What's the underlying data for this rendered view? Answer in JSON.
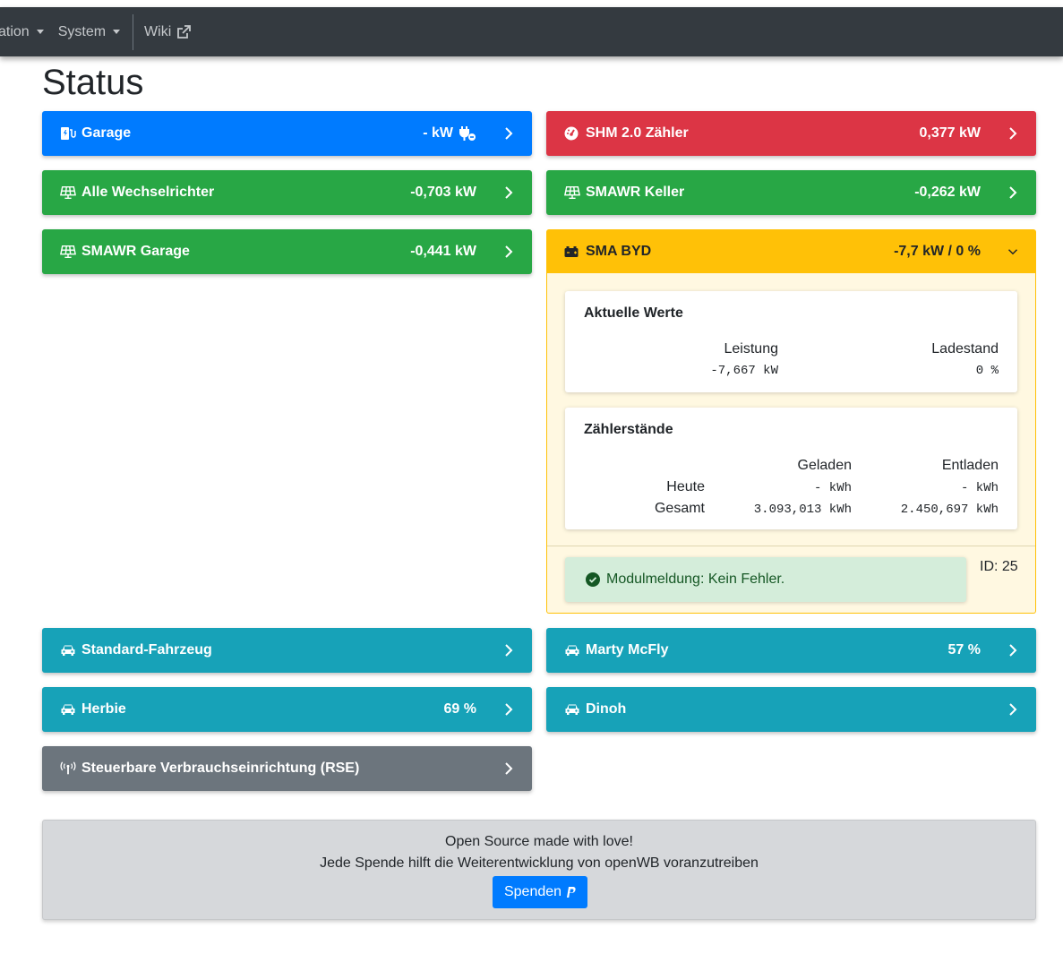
{
  "nav": {
    "item_partial": "ation",
    "system": "System",
    "wiki": "Wiki"
  },
  "page_title": "Status",
  "cards": {
    "garage": {
      "label": "Garage",
      "value": "- kW"
    },
    "shm": {
      "label": "SHM 2.0 Zähler",
      "value": "0,377 kW"
    },
    "alle_wr": {
      "label": "Alle Wechselrichter",
      "value": "-0,703 kW"
    },
    "smawr_keller": {
      "label": "SMAWR Keller",
      "value": "-0,262 kW"
    },
    "smawr_garage": {
      "label": "SMAWR Garage",
      "value": "-0,441 kW"
    },
    "sma_byd": {
      "label": "SMA BYD",
      "value": "-7,7 kW / 0 %"
    },
    "standard_fz": {
      "label": "Standard-Fahrzeug",
      "value": ""
    },
    "marty": {
      "label": "Marty McFly",
      "value": "57 %"
    },
    "herbie": {
      "label": "Herbie",
      "value": "69 %"
    },
    "dinoh": {
      "label": "Dinoh",
      "value": ""
    },
    "rse": {
      "label": "Steuerbare Verbrauchseinrichtung (RSE)",
      "value": ""
    }
  },
  "byd_detail": {
    "current": {
      "title": "Aktuelle Werte",
      "leistung_label": "Leistung",
      "leistung_value": "-7,667 kW",
      "ladestand_label": "Ladestand",
      "ladestand_value": "0 %"
    },
    "counters": {
      "title": "Zählerstände",
      "geladen": "Geladen",
      "entladen": "Entladen",
      "heute": "Heute",
      "gesamt": "Gesamt",
      "heute_geladen": "- kWh",
      "heute_entladen": "- kWh",
      "gesamt_geladen": "3.093,013 kWh",
      "gesamt_entladen": "2.450,697 kWh"
    },
    "module_message": "Modulmeldung: Kein Fehler.",
    "id": "ID: 25"
  },
  "footer": {
    "line1": "Open Source made with love!",
    "line2": "Jede Spende hilft die Weiterentwicklung von openWB voranzutreiben",
    "donate": "Spenden"
  },
  "colors": {
    "blue": "#007bff",
    "red": "#dc3545",
    "green": "#28a745",
    "yellow": "#ffc107",
    "teal": "#17a2b8",
    "gray": "#6c757d",
    "navbar": "#343a40"
  }
}
